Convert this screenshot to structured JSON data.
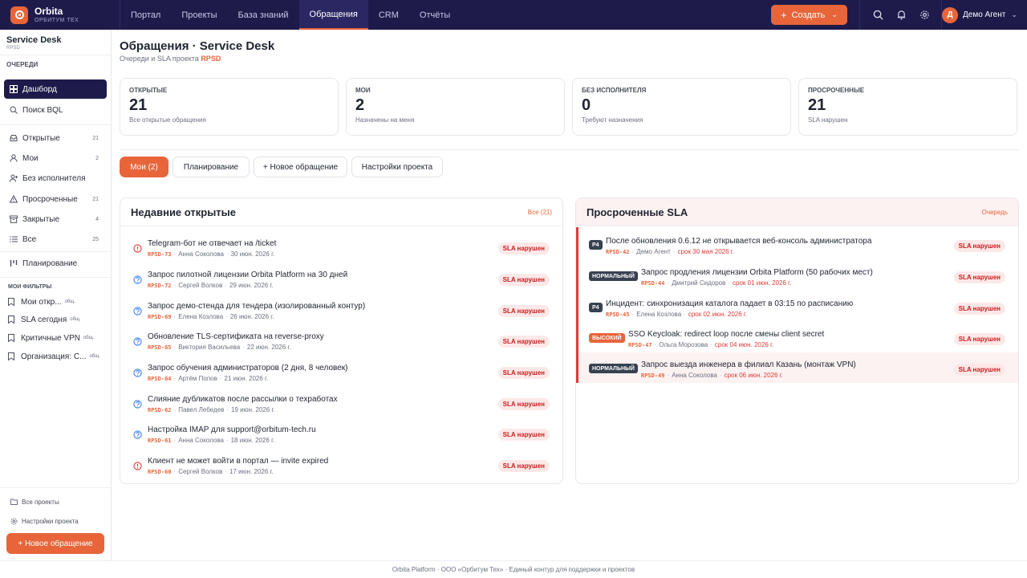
{
  "app": {
    "name": "Orbita",
    "subtitle": "ОРБИТУМ ТЕХ"
  },
  "nav": {
    "items": [
      "Портал",
      "Проекты",
      "База знаний",
      "Обращения",
      "CRM",
      "Отчёты"
    ],
    "active": "Обращения"
  },
  "toolbar": {
    "create_label": "Создать"
  },
  "user": {
    "initial": "Д",
    "name": "Демо Агент"
  },
  "sidebar": {
    "project_title": "Service Desk",
    "project_code": "RPSD",
    "section_label": "ОЧЕРЕДИ",
    "items": [
      {
        "label": "Дашборд",
        "count": "",
        "icon": "dashboard-icon"
      },
      {
        "label": "Поиск BQL",
        "count": "",
        "icon": "search-icon"
      },
      {
        "label": "Открытые",
        "count": "21",
        "icon": "inbox-icon"
      },
      {
        "label": "Мои",
        "count": "2",
        "icon": "user-icon"
      },
      {
        "label": "Без исполнителя",
        "count": "",
        "icon": "user-plus-icon"
      },
      {
        "label": "Просроченные",
        "count": "21",
        "icon": "warning-icon"
      },
      {
        "label": "Закрытые",
        "count": "4",
        "icon": "archive-icon"
      },
      {
        "label": "Все",
        "count": "25",
        "icon": "list-icon"
      },
      {
        "label": "Планирование",
        "count": "",
        "icon": "kanban-icon"
      }
    ],
    "filters_label": "МОИ ФИЛЬТРЫ",
    "filters": [
      {
        "label": "Мои откр...",
        "tag": "общ."
      },
      {
        "label": "SLA сегодня",
        "tag": "общ."
      },
      {
        "label": "Критичные VPN",
        "tag": "общ."
      },
      {
        "label": "Организация: С...",
        "tag": "общ."
      }
    ],
    "all_projects": "Все проекты",
    "project_settings": "Настройки проекта",
    "new_ticket": "+ Новое обращение"
  },
  "page": {
    "title": "Обращения · Service Desk",
    "subtitle_prefix": "Очереди и SLA проекта",
    "subtitle_code": "RPSD"
  },
  "stats": [
    {
      "label": "ОТКРЫТЫЕ",
      "value": "21",
      "desc": "Все открытые обращения"
    },
    {
      "label": "МОИ",
      "value": "2",
      "desc": "Назначены на меня"
    },
    {
      "label": "БЕЗ ИСПОЛНИТЕЛЯ",
      "value": "0",
      "desc": "Требуют назначения"
    },
    {
      "label": "ПРОСРОЧЕННЫЕ",
      "value": "21",
      "desc": "SLA нарушен"
    }
  ],
  "tabs": [
    "Мои (2)",
    "Планирование",
    "+ Новое обращение",
    "Настройки проекта"
  ],
  "recent": {
    "title": "Недавние открытые",
    "link": "Все (21)",
    "rows": [
      {
        "icon": "alert-circle-icon",
        "title": "Telegram-бот не отвечает на /ticket",
        "code": "RPSD-73",
        "person": "Анна Соколова",
        "date": "30 июн. 2026 г.",
        "badge": "SLA нарушен"
      },
      {
        "icon": "question-circle-icon",
        "title": "Запрос пилотной лицензии Orbita Platform на 30 дней",
        "code": "RPSD-72",
        "person": "Сергей Волков",
        "date": "29 июн. 2026 г.",
        "badge": "SLA нарушен"
      },
      {
        "icon": "question-circle-icon",
        "title": "Запрос демо-стенда для тендера (изолированный контур)",
        "code": "RPSD-69",
        "person": "Елена Козлова",
        "date": "26 июн. 2026 г.",
        "badge": "SLA нарушен"
      },
      {
        "icon": "question-circle-icon",
        "title": "Обновление TLS-сертификата на reverse-proxy",
        "code": "RPSD-65",
        "person": "Виктория Васильева",
        "date": "22 июн. 2026 г.",
        "badge": "SLA нарушен"
      },
      {
        "icon": "question-circle-icon",
        "title": "Запрос обучения администраторов (2 дня, 8 человек)",
        "code": "RPSD-64",
        "person": "Артём Попов",
        "date": "21 июн. 2026 г.",
        "badge": "SLA нарушен"
      },
      {
        "icon": "question-circle-icon",
        "title": "Слияние дубликатов после рассылки о техработах",
        "code": "RPSD-62",
        "person": "Павел Лебедев",
        "date": "19 июн. 2026 г.",
        "badge": "SLA нарушен"
      },
      {
        "icon": "question-circle-icon",
        "title": "Настройка IMAP для support@orbitum-tech.ru",
        "code": "RPSD-61",
        "person": "Анна Соколова",
        "date": "18 июн. 2026 г.",
        "badge": "SLA нарушен"
      },
      {
        "icon": "alert-circle-icon",
        "title": "Клиент не может войти в портал — invite expired",
        "code": "RPSD-60",
        "person": "Сергей Волков",
        "date": "17 июн. 2026 г.",
        "badge": "SLA нарушен"
      }
    ]
  },
  "overdue": {
    "title": "Просроченные SLA",
    "link": "Очередь",
    "rows": [
      {
        "priority": "P4",
        "prio_style": "dark",
        "title": "После обновления 0.6.12 не открывается веб-консоль администратора",
        "code": "RPSD-42",
        "person": "Демо Агент",
        "due": "срок 30 мая 2026 г.",
        "badge": "SLA нарушен"
      },
      {
        "priority": "НОРМАЛЬНЫЙ",
        "prio_style": "dark",
        "title": "Запрос продления лицензии Orbita Platform (50 рабочих мест)",
        "code": "RPSD-44",
        "person": "Дмитрий Сидоров",
        "due": "срок 01 июн. 2026 г.",
        "badge": "SLA нарушен"
      },
      {
        "priority": "P4",
        "prio_style": "dark",
        "title": "Инцидент: синхронизация каталога падает в 03:15 по расписанию",
        "code": "RPSD-45",
        "person": "Елена Козлова",
        "due": "срок 02 июн. 2026 г.",
        "badge": "SLA нарушен"
      },
      {
        "priority": "ВЫСОКИЙ",
        "prio_style": "high",
        "title": "SSO Keycloak: redirect loop после смены client secret",
        "code": "RPSD-47",
        "person": "Ольга Морозова",
        "due": "срок 04 июн. 2026 г.",
        "badge": "SLA нарушен"
      },
      {
        "priority": "НОРМАЛЬНЫЙ",
        "prio_style": "dark",
        "title": "Запрос выезда инженера в филиал Казань (монтаж VPN)",
        "code": "RPSD-49",
        "person": "Анна Соколова",
        "due": "срок 06 июн. 2026 г.",
        "badge": "SLA нарушен"
      }
    ]
  },
  "footer": "Orbita Platform · ООО «Орбитум Тех» · Единый контур для поддержки и проектов",
  "colors": {
    "navy": "#1e1b4b",
    "accent": "#e8653a",
    "danger": "#e03a3a"
  }
}
